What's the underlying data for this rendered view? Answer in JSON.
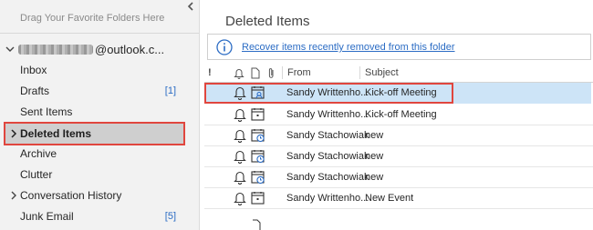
{
  "sidebar": {
    "favorites_hint": "Drag Your Favorite Folders Here",
    "account_suffix": "@outlook.c...",
    "folders": [
      {
        "label": "Inbox",
        "count": ""
      },
      {
        "label": "Drafts",
        "count": "[1]"
      },
      {
        "label": "Sent Items",
        "count": ""
      },
      {
        "label": "Deleted Items",
        "count": "",
        "selected": true
      },
      {
        "label": "Archive",
        "count": ""
      },
      {
        "label": "Clutter",
        "count": ""
      },
      {
        "label": "Conversation History",
        "count": ""
      },
      {
        "label": "Junk Email",
        "count": "[5]"
      }
    ]
  },
  "main": {
    "title": "Deleted Items",
    "recover_link": "Recover items recently removed from this folder",
    "columns": {
      "importance": "!",
      "from": "From",
      "subject": "Subject"
    },
    "rows": [
      {
        "from": "Sandy Writtenho...",
        "subject": "Kick-off Meeting",
        "selected": true,
        "icon": "meeting-response-icon"
      },
      {
        "from": "Sandy Writtenho...",
        "subject": "Kick-off Meeting",
        "icon": "calendar-icon"
      },
      {
        "from": "Sandy Stachowiak",
        "subject": "new",
        "icon": "calendar-clock-icon"
      },
      {
        "from": "Sandy Stachowiak",
        "subject": "new",
        "icon": "calendar-clock-icon"
      },
      {
        "from": "Sandy Stachowiak",
        "subject": "new",
        "icon": "calendar-clock-icon"
      },
      {
        "from": "Sandy Writtenho...",
        "subject": "New Event",
        "icon": "calendar-icon"
      }
    ]
  },
  "colors": {
    "selection": "#cde4f7",
    "highlight_border": "#e0463e",
    "link": "#2b6cc4",
    "folder_pane_bg": "#f2f2f2",
    "selected_folder_bg": "#cfcfcf"
  }
}
